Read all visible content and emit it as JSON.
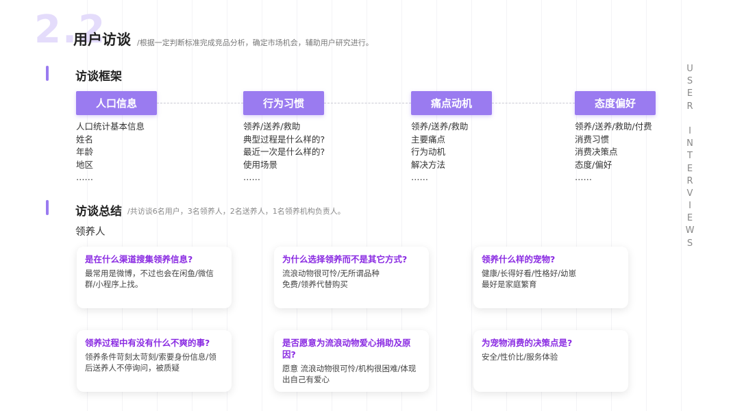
{
  "header": {
    "number": "2.2",
    "title": "用户访谈",
    "subtitle": "/根据一定判断标准完成竞品分析，确定市场机会，辅助用户研究进行。"
  },
  "side_text": [
    "U",
    "S",
    "E",
    "R",
    "",
    "I",
    "N",
    "T",
    "E",
    "R",
    "V",
    "I",
    "E",
    "W",
    "S"
  ],
  "framework": {
    "title": "访谈框架",
    "columns": [
      {
        "label": "人口信息",
        "items": [
          "人口统计基本信息",
          "姓名",
          "年龄",
          "地区",
          "……"
        ]
      },
      {
        "label": "行为习惯",
        "items": [
          "领养/送养/救助",
          "典型过程是什么样的?",
          "最近一次是什么样的?",
          "使用场景",
          "……"
        ]
      },
      {
        "label": "痛点动机",
        "items": [
          "领养/送养/救助",
          "主要痛点",
          "行为动机",
          "解决方法",
          "……"
        ]
      },
      {
        "label": "态度偏好",
        "items": [
          "领养/送养/救助/付费",
          "消费习惯",
          "消费决策点",
          "态度/偏好",
          "……"
        ]
      }
    ]
  },
  "summary": {
    "title": "访谈总结",
    "note": "/共访谈6名用户，3名领养人，2名送养人，1名领养机构负责人。",
    "group_label": "领养人",
    "cards": [
      {
        "q": "是在什么渠道搜集领养信息?",
        "a": "最常用是微博，不过也会在闲鱼/微信群/小程序上找。"
      },
      {
        "q": "为什么选择领养而不是其它方式?",
        "a": "流浪动物很可怜/无所谓品种\n免费/领养代替购买"
      },
      {
        "q": "领养什么样的宠物?",
        "a": "健康/长得好看/性格好/幼崽\n最好是家庭繁育"
      },
      {
        "q": "领养过程中有没有什么不爽的事?",
        "a": "领养条件苛刻太苛刻/索要身份信息/领后送养人不停询问，被质疑"
      },
      {
        "q": "是否愿意为流浪动物爱心捐助及原因?",
        "a": "愿意 流浪动物很可怜/机构很困难/体现出自己有爱心"
      },
      {
        "q": "为宠物消费的决策点是?",
        "a": "安全/性价比/服务体验"
      }
    ]
  },
  "colors": {
    "accent": "#9a7bf0",
    "question": "#8a2be2",
    "number_bg": "#e4dcfb"
  }
}
